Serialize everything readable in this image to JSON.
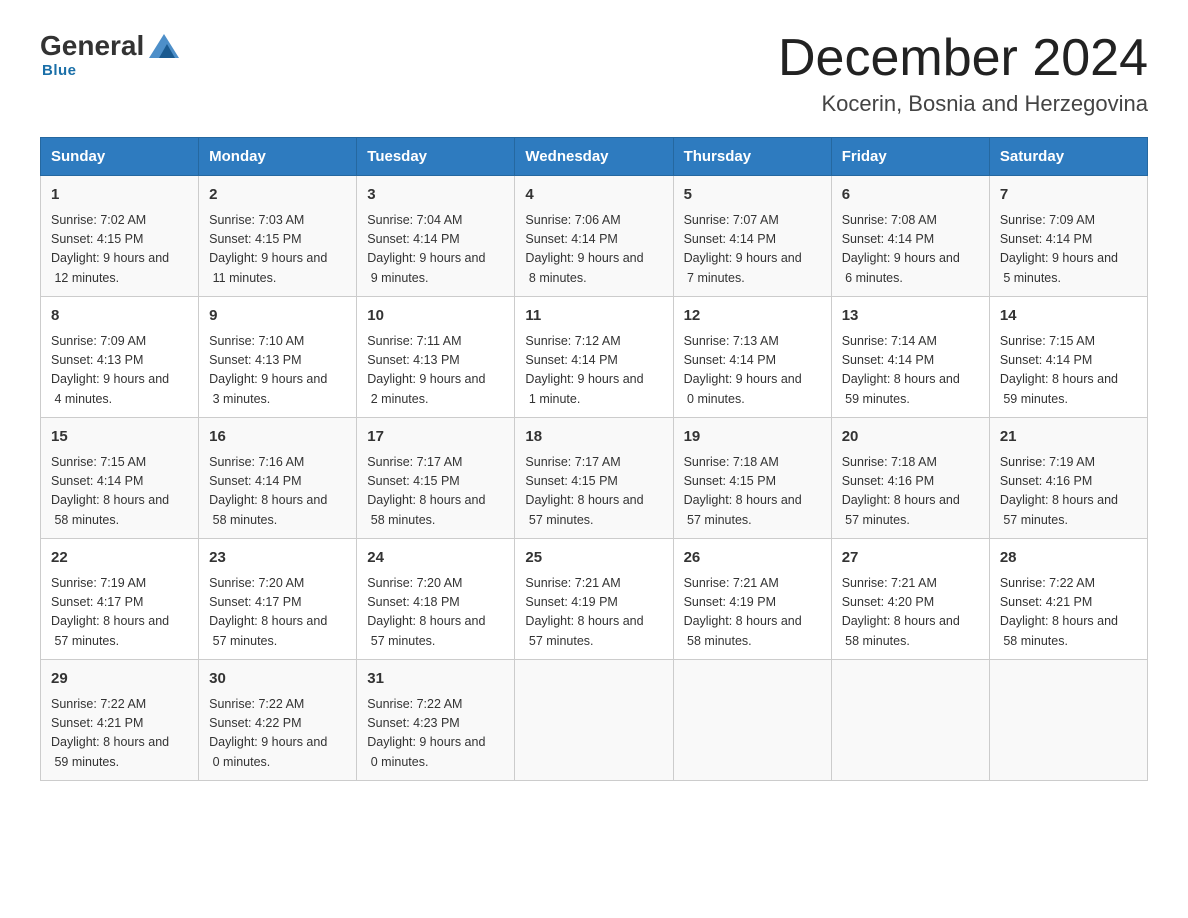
{
  "logo": {
    "part1": "General",
    "part2": "Blue"
  },
  "title": "December 2024",
  "location": "Kocerin, Bosnia and Herzegovina",
  "weekdays": [
    "Sunday",
    "Monday",
    "Tuesday",
    "Wednesday",
    "Thursday",
    "Friday",
    "Saturday"
  ],
  "weeks": [
    [
      {
        "day": "1",
        "sunrise": "7:02 AM",
        "sunset": "4:15 PM",
        "daylight": "9 hours and 12 minutes."
      },
      {
        "day": "2",
        "sunrise": "7:03 AM",
        "sunset": "4:15 PM",
        "daylight": "9 hours and 11 minutes."
      },
      {
        "day": "3",
        "sunrise": "7:04 AM",
        "sunset": "4:14 PM",
        "daylight": "9 hours and 9 minutes."
      },
      {
        "day": "4",
        "sunrise": "7:06 AM",
        "sunset": "4:14 PM",
        "daylight": "9 hours and 8 minutes."
      },
      {
        "day": "5",
        "sunrise": "7:07 AM",
        "sunset": "4:14 PM",
        "daylight": "9 hours and 7 minutes."
      },
      {
        "day": "6",
        "sunrise": "7:08 AM",
        "sunset": "4:14 PM",
        "daylight": "9 hours and 6 minutes."
      },
      {
        "day": "7",
        "sunrise": "7:09 AM",
        "sunset": "4:14 PM",
        "daylight": "9 hours and 5 minutes."
      }
    ],
    [
      {
        "day": "8",
        "sunrise": "7:09 AM",
        "sunset": "4:13 PM",
        "daylight": "9 hours and 4 minutes."
      },
      {
        "day": "9",
        "sunrise": "7:10 AM",
        "sunset": "4:13 PM",
        "daylight": "9 hours and 3 minutes."
      },
      {
        "day": "10",
        "sunrise": "7:11 AM",
        "sunset": "4:13 PM",
        "daylight": "9 hours and 2 minutes."
      },
      {
        "day": "11",
        "sunrise": "7:12 AM",
        "sunset": "4:14 PM",
        "daylight": "9 hours and 1 minute."
      },
      {
        "day": "12",
        "sunrise": "7:13 AM",
        "sunset": "4:14 PM",
        "daylight": "9 hours and 0 minutes."
      },
      {
        "day": "13",
        "sunrise": "7:14 AM",
        "sunset": "4:14 PM",
        "daylight": "8 hours and 59 minutes."
      },
      {
        "day": "14",
        "sunrise": "7:15 AM",
        "sunset": "4:14 PM",
        "daylight": "8 hours and 59 minutes."
      }
    ],
    [
      {
        "day": "15",
        "sunrise": "7:15 AM",
        "sunset": "4:14 PM",
        "daylight": "8 hours and 58 minutes."
      },
      {
        "day": "16",
        "sunrise": "7:16 AM",
        "sunset": "4:14 PM",
        "daylight": "8 hours and 58 minutes."
      },
      {
        "day": "17",
        "sunrise": "7:17 AM",
        "sunset": "4:15 PM",
        "daylight": "8 hours and 58 minutes."
      },
      {
        "day": "18",
        "sunrise": "7:17 AM",
        "sunset": "4:15 PM",
        "daylight": "8 hours and 57 minutes."
      },
      {
        "day": "19",
        "sunrise": "7:18 AM",
        "sunset": "4:15 PM",
        "daylight": "8 hours and 57 minutes."
      },
      {
        "day": "20",
        "sunrise": "7:18 AM",
        "sunset": "4:16 PM",
        "daylight": "8 hours and 57 minutes."
      },
      {
        "day": "21",
        "sunrise": "7:19 AM",
        "sunset": "4:16 PM",
        "daylight": "8 hours and 57 minutes."
      }
    ],
    [
      {
        "day": "22",
        "sunrise": "7:19 AM",
        "sunset": "4:17 PM",
        "daylight": "8 hours and 57 minutes."
      },
      {
        "day": "23",
        "sunrise": "7:20 AM",
        "sunset": "4:17 PM",
        "daylight": "8 hours and 57 minutes."
      },
      {
        "day": "24",
        "sunrise": "7:20 AM",
        "sunset": "4:18 PM",
        "daylight": "8 hours and 57 minutes."
      },
      {
        "day": "25",
        "sunrise": "7:21 AM",
        "sunset": "4:19 PM",
        "daylight": "8 hours and 57 minutes."
      },
      {
        "day": "26",
        "sunrise": "7:21 AM",
        "sunset": "4:19 PM",
        "daylight": "8 hours and 58 minutes."
      },
      {
        "day": "27",
        "sunrise": "7:21 AM",
        "sunset": "4:20 PM",
        "daylight": "8 hours and 58 minutes."
      },
      {
        "day": "28",
        "sunrise": "7:22 AM",
        "sunset": "4:21 PM",
        "daylight": "8 hours and 58 minutes."
      }
    ],
    [
      {
        "day": "29",
        "sunrise": "7:22 AM",
        "sunset": "4:21 PM",
        "daylight": "8 hours and 59 minutes."
      },
      {
        "day": "30",
        "sunrise": "7:22 AM",
        "sunset": "4:22 PM",
        "daylight": "9 hours and 0 minutes."
      },
      {
        "day": "31",
        "sunrise": "7:22 AM",
        "sunset": "4:23 PM",
        "daylight": "9 hours and 0 minutes."
      },
      null,
      null,
      null,
      null
    ]
  ],
  "labels": {
    "sunrise": "Sunrise:",
    "sunset": "Sunset:",
    "daylight": "Daylight:"
  }
}
